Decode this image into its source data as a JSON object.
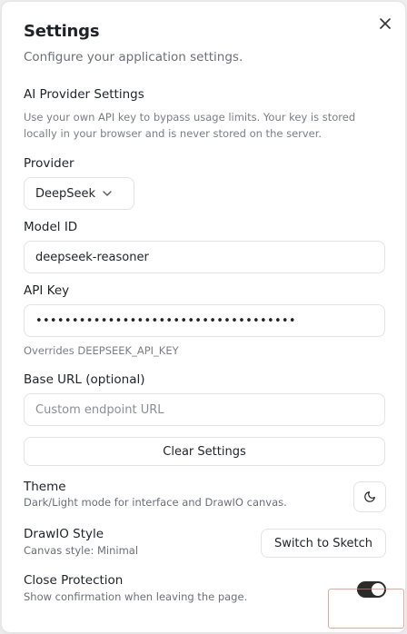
{
  "dialog": {
    "title": "Settings",
    "subtitle": "Configure your application settings."
  },
  "ai_provider": {
    "title": "AI Provider Settings",
    "description": "Use your own API key to bypass usage limits. Your key is stored locally in your browser and is never stored on the server.",
    "provider": {
      "label": "Provider",
      "value": "DeepSeek"
    },
    "model_id": {
      "label": "Model ID",
      "value": "deepseek-reasoner"
    },
    "api_key": {
      "label": "API Key",
      "value": "••••••••••••••••••••••••••••••••••••",
      "hint": "Overrides DEEPSEEK_API_KEY"
    },
    "base_url": {
      "label": "Base URL (optional)",
      "placeholder": "Custom endpoint URL"
    },
    "clear_label": "Clear Settings"
  },
  "theme": {
    "title": "Theme",
    "description": "Dark/Light mode for interface and DrawIO canvas.",
    "icon": "moon-icon"
  },
  "drawio_style": {
    "title": "DrawIO Style",
    "description": "Canvas style: Minimal",
    "button_label": "Switch to Sketch"
  },
  "close_protection": {
    "title": "Close Protection",
    "description": "Show confirmation when leaving the page.",
    "enabled": true
  },
  "colors": {
    "toggle_on": "#2b2b2b",
    "border": "#e3e3e3",
    "muted_text": "#6b6f76"
  }
}
